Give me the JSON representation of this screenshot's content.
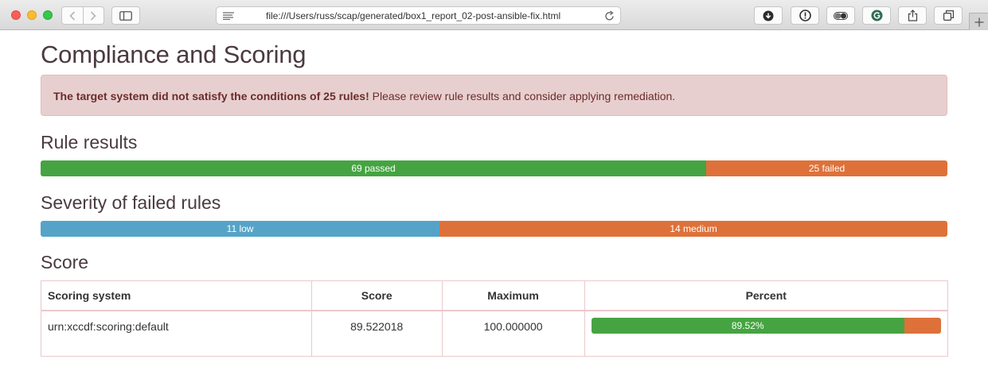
{
  "browser": {
    "url": "file:///Users/russ/scap/generated/box1_report_02-post-ansible-fix.html"
  },
  "page": {
    "title": "Compliance and Scoring",
    "alert": {
      "bold": "The target system did not satisfy the conditions of 25 rules!",
      "text": " Please review rule results and consider applying remediation."
    },
    "rule_results": {
      "heading": "Rule results",
      "passed": {
        "count": 69,
        "label": "69 passed",
        "color": "#45a441"
      },
      "failed": {
        "count": 25,
        "label": "25 failed",
        "color": "#de7139"
      }
    },
    "severity": {
      "heading": "Severity of failed rules",
      "low": {
        "count": 11,
        "label": "11 low",
        "color": "#55a4c8"
      },
      "medium": {
        "count": 14,
        "label": "14 medium",
        "color": "#de7139"
      }
    },
    "score": {
      "heading": "Score",
      "columns": [
        "Scoring system",
        "Score",
        "Maximum",
        "Percent"
      ],
      "rows": [
        {
          "system": "urn:xccdf:scoring:default",
          "score": "89.522018",
          "maximum": "100.000000",
          "percent_label": "89.52%",
          "percent_value": 89.52
        }
      ]
    }
  },
  "icons": [
    "back-icon",
    "forward-icon",
    "sidebar-icon",
    "reader-icon",
    "reload-icon",
    "download-icon",
    "info-icon",
    "toggle-icon",
    "grammarly-icon",
    "share-icon",
    "tabs-icon",
    "new-tab-icon"
  ]
}
